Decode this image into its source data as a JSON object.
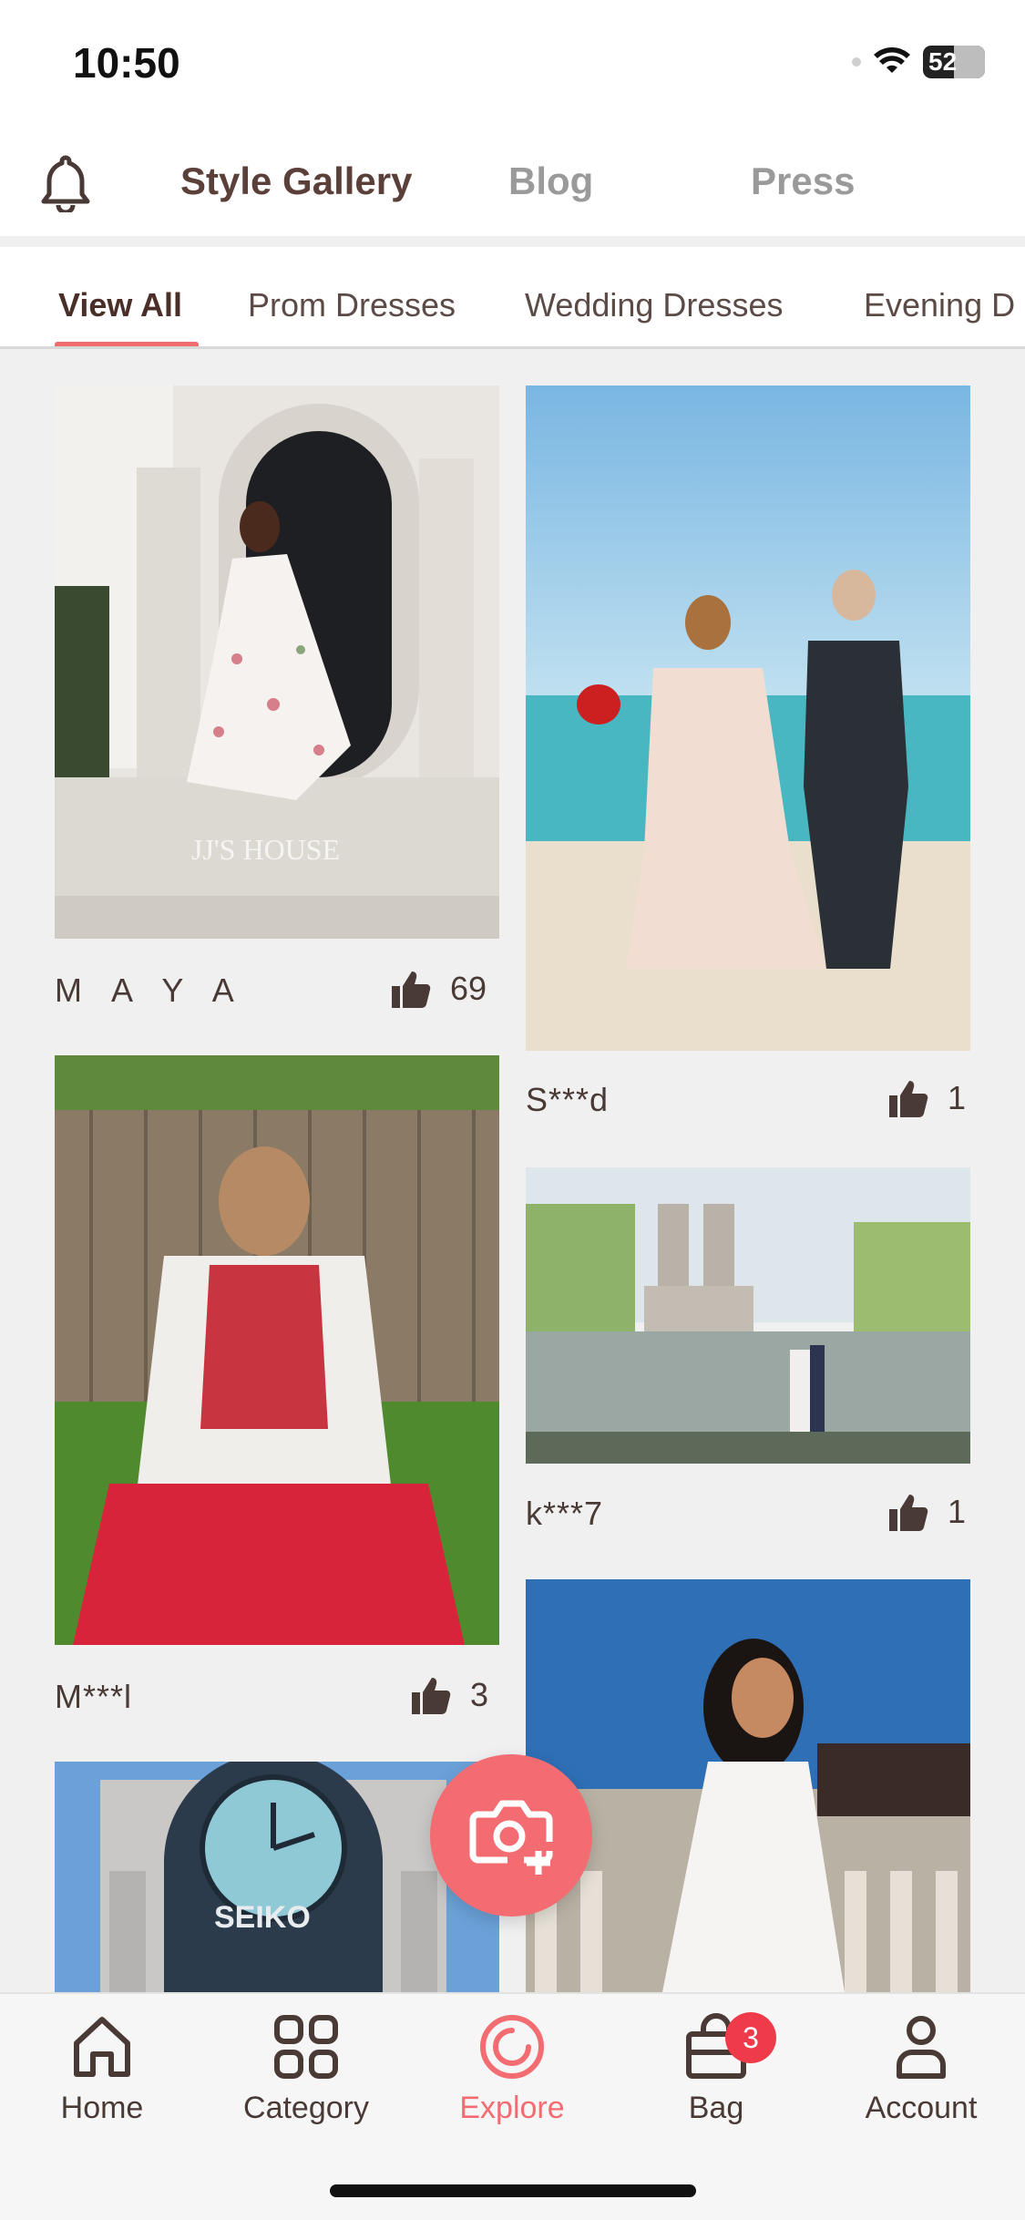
{
  "status": {
    "time": "10:50",
    "battery": "52"
  },
  "top_nav": {
    "tabs": [
      "Style Gallery",
      "Blog",
      "Press"
    ]
  },
  "sub_tabs": [
    "View All",
    "Prom Dresses",
    "Wedding Dresses",
    "Evening D"
  ],
  "photo_watermark": "JJ'S HOUSE",
  "clock_brand": "SEIKO",
  "cards": [
    {
      "name": "M A Y A",
      "likes": "69"
    },
    {
      "name": "S***d",
      "likes": "1"
    },
    {
      "name": "M***l",
      "likes": "3"
    },
    {
      "name": "k***7",
      "likes": "1"
    }
  ],
  "bottom_nav": [
    {
      "label": "Home",
      "icon": "home-icon"
    },
    {
      "label": "Category",
      "icon": "grid-icon"
    },
    {
      "label": "Explore",
      "icon": "explore-icon"
    },
    {
      "label": "Bag",
      "icon": "bag-icon",
      "badge": "3"
    },
    {
      "label": "Account",
      "icon": "person-icon"
    }
  ],
  "colors": {
    "accent": "#f26c72",
    "badge": "#ef3a4a",
    "text": "#4a3a36"
  }
}
